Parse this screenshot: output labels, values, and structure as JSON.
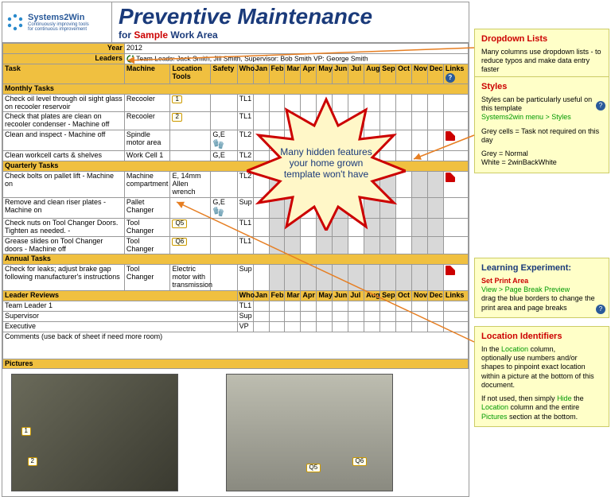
{
  "logo": {
    "name": "Systems2Win",
    "tagline1": "Continuously improving tools",
    "tagline2": "for continuous improvement"
  },
  "title": "Preventive Maintenance",
  "subtitle": {
    "for": "for",
    "sample": "Sample",
    "area": "Work Area"
  },
  "year": {
    "label": "Year",
    "value": "2012"
  },
  "leaders": {
    "label": "Leaders",
    "value": "Team Leads: Jack Smith, Jill Smith, Supervisor: Bob Smith  VP: George Smith"
  },
  "cols": {
    "task": "Task",
    "machine": "Machine",
    "location": "Location Tools",
    "safety": "Safety",
    "who": "Who",
    "months": [
      "Jan",
      "Feb",
      "Mar",
      "Apr",
      "May",
      "Jun",
      "Jul",
      "Aug",
      "Sep",
      "Oct",
      "Nov",
      "Dec"
    ],
    "links": "Links"
  },
  "sections": {
    "monthly": "Monthly Tasks",
    "quarterly": "Quarterly Tasks",
    "annual": "Annual Tasks",
    "reviews": "Leader Reviews",
    "pictures": "Pictures"
  },
  "rows": {
    "m1": {
      "task": "Check oil level through oil sight glass on recooler reservoir",
      "machine": "Recooler",
      "loc": "1",
      "who": "TL1"
    },
    "m2": {
      "task": "Check that plates are clean on recooler condenser - Machine off",
      "machine": "Recooler",
      "loc": "2",
      "who": "TL1"
    },
    "m3": {
      "task": "Clean and  inspect - Machine off",
      "machine": "Spindle motor area",
      "safety": "G,E",
      "who": "TL2"
    },
    "m4": {
      "task": "Clean workcell carts & shelves",
      "machine": "Work Cell 1",
      "safety": "G,E",
      "who": "TL2"
    },
    "q1": {
      "task": "Check bolts on pallet lift - Machine on",
      "machine": "Machine compartment",
      "loc": "E, 14mm Allen wrench",
      "who": "TL2"
    },
    "q2": {
      "task": "Remove and clean riser plates - Machine on",
      "machine": "Pallet Changer",
      "safety": "G,E",
      "who": "Sup"
    },
    "q3": {
      "task": "Check nuts on Tool Changer Doors. Tighten as needed. -",
      "machine": "Tool Changer",
      "loc": "Q5",
      "who": "TL1"
    },
    "q4": {
      "task": "Grease slides on Tool Changer doors - Machine off",
      "machine": "Tool Changer",
      "loc": "Q6",
      "who": "TL1"
    },
    "a1": {
      "task": "Check for leaks; adjust brake gap following manufacturer's instructions",
      "machine": "Tool Changer",
      "loc": "Electric motor with transmission",
      "who": "Sup"
    },
    "r1": {
      "task": "Team Leader 1",
      "who": "TL1"
    },
    "r2": {
      "task": "Supervisor",
      "who": "Sup"
    },
    "r3": {
      "task": "Executive",
      "who": "VP"
    }
  },
  "comments": "Comments (use back of sheet if need more room)",
  "starburst": "Many hidden features your home grown template won't have",
  "callouts": {
    "dropdown": {
      "title": "Dropdown Lists",
      "body": "Many columns use dropdown lists - to reduce typos and make data entry faster"
    },
    "styles": {
      "title": "Styles",
      "l1": "Styles can be particularly useful on this template",
      "l2": "Systems2win menu > Styles",
      "l3": "Grey cells = Task not required on this day",
      "l4": "Grey = Normal",
      "l5": "White = 2winBackWhite"
    },
    "learn": {
      "title": "Learning Experiment:",
      "sub": "Set Print Area",
      "l1": "View > Page Break Preview",
      "l2": "drag the blue borders to change the print area and page breaks"
    },
    "loc": {
      "title": "Location Identifiers",
      "l1a": "In the ",
      "l1b": "Location",
      "l1c": " column,",
      "l2": "optionally use numbers and/or shapes to pinpoint exact location within a picture at the bottom of this document.",
      "l3a": "If not used, then simply ",
      "l3b": "Hide",
      "l3c": " the ",
      "l3d": "Location",
      "l3e": " column and the entire ",
      "l3f": "Pictures",
      "l3g": " section at the bottom."
    }
  },
  "pic_tags": {
    "p1a": "1",
    "p1b": "2",
    "p2a": "Q5",
    "p2b": "Q6"
  }
}
